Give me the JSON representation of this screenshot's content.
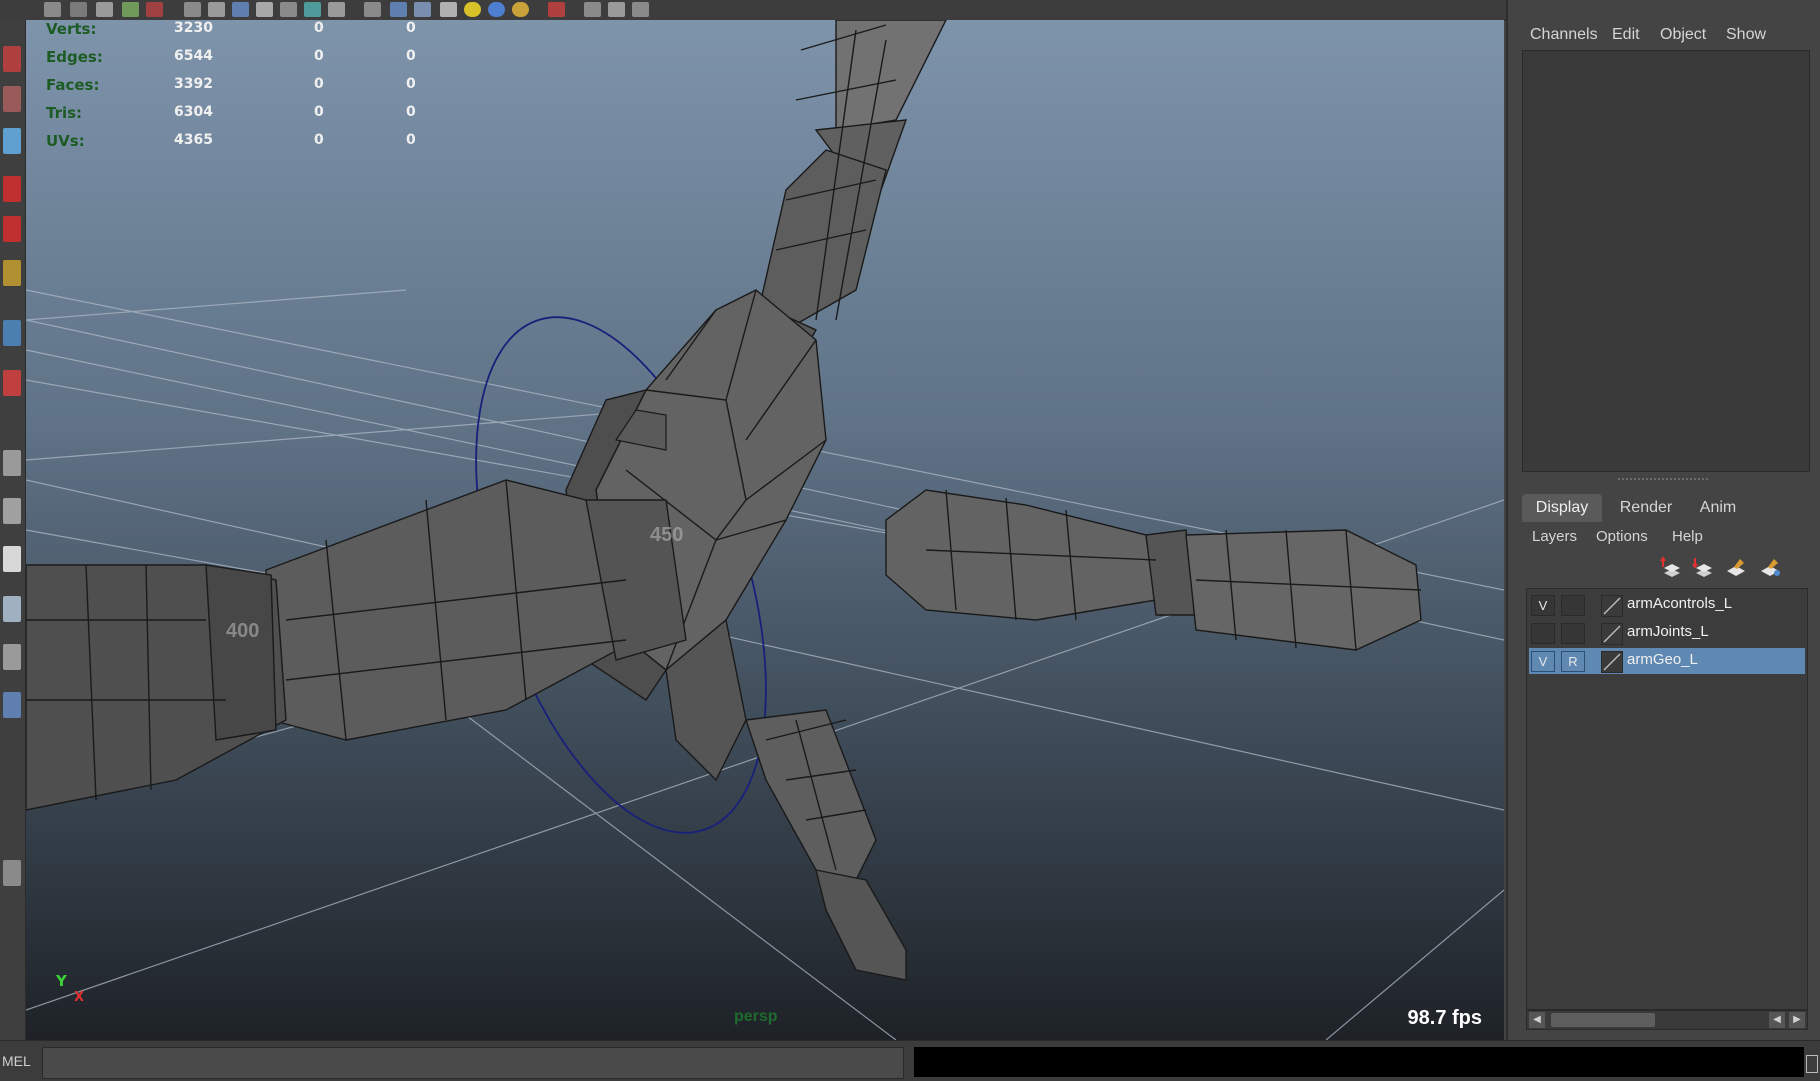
{
  "viewport": {
    "hud": [
      {
        "label": "Verts:",
        "v1": "3230",
        "v2": "0",
        "v3": "0"
      },
      {
        "label": "Edges:",
        "v1": "6544",
        "v2": "0",
        "v3": "0"
      },
      {
        "label": "Faces:",
        "v1": "3392",
        "v2": "0",
        "v3": "0"
      },
      {
        "label": "Tris:",
        "v1": "6304",
        "v2": "0",
        "v3": "0"
      },
      {
        "label": "UVs:",
        "v1": "4365",
        "v2": "0",
        "v3": "0"
      }
    ],
    "fps": "98.7 fps",
    "camera": "persp",
    "grid_labels": [
      "450",
      "400"
    ],
    "axis": {
      "y": "Y",
      "x": "X"
    }
  },
  "channel_box": {
    "menu": [
      "Channels",
      "Edit",
      "Object",
      "Show"
    ]
  },
  "layer_editor": {
    "tabs": [
      "Display",
      "Render",
      "Anim"
    ],
    "active_tab": "Display",
    "menu": [
      "Layers",
      "Options",
      "Help"
    ],
    "layers": [
      {
        "visible": "V",
        "reference": "",
        "name": "armAcontrols_L",
        "selected": false
      },
      {
        "visible": "",
        "reference": "",
        "name": "armJoints_L",
        "selected": false
      },
      {
        "visible": "V",
        "reference": "R",
        "name": "armGeo_L",
        "selected": true
      }
    ]
  },
  "command_line": {
    "label": "MEL"
  },
  "colors": {
    "selection": "#5f88b3",
    "hud_label": "#1d5b24",
    "viewport_top": "#7e94ab",
    "viewport_bottom": "#1e2227"
  },
  "icons": [
    "move-layer-up-icon",
    "move-layer-down-icon",
    "new-layer-icon",
    "new-layer-from-selected-icon"
  ]
}
